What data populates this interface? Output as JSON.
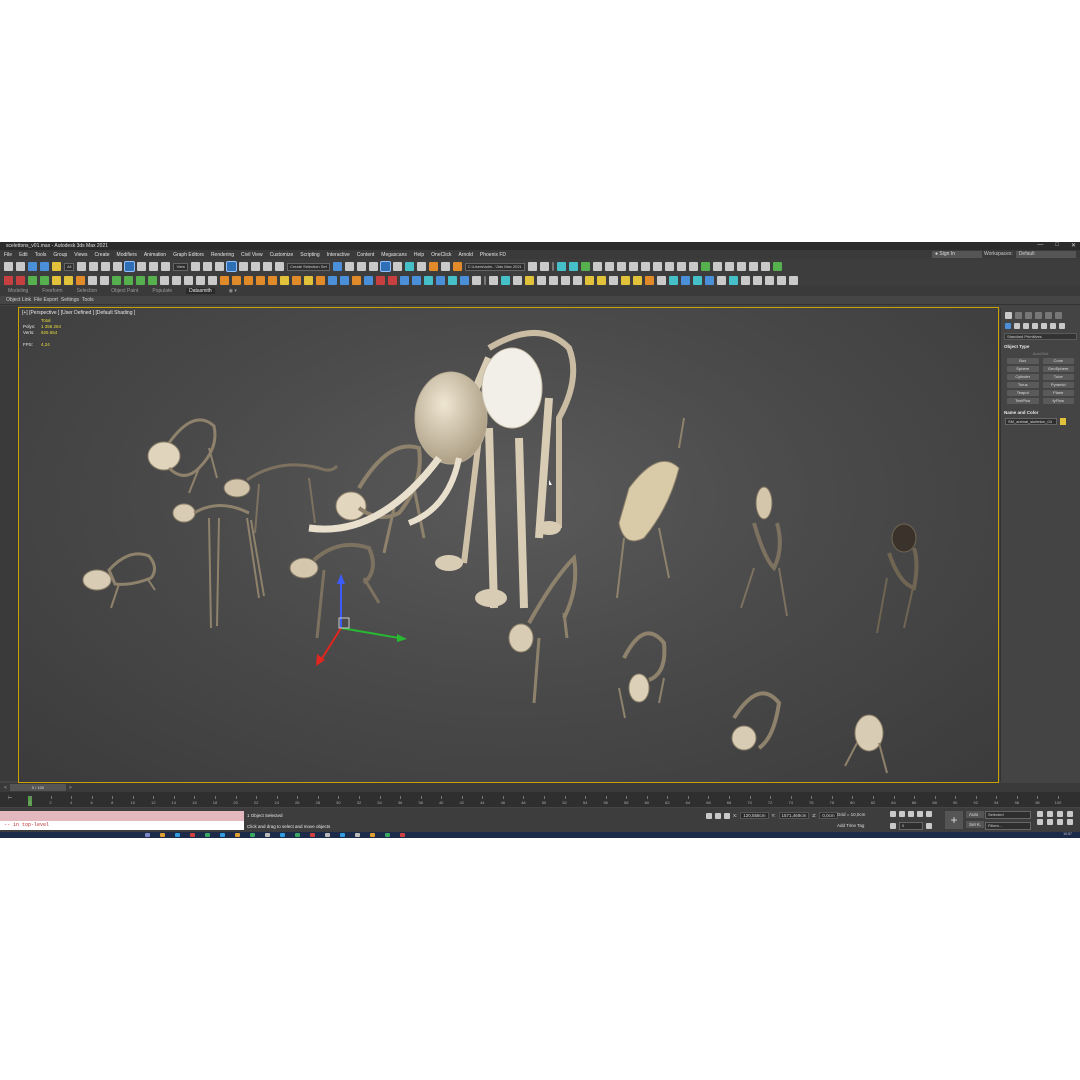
{
  "window": {
    "title": "scelettons_v01.max - Autodesk 3ds Max 2021",
    "controls": [
      "—",
      "□",
      "✕"
    ]
  },
  "menu": [
    "File",
    "Edit",
    "Tools",
    "Group",
    "Views",
    "Create",
    "Modifiers",
    "Animation",
    "Graph Editors",
    "Rendering",
    "Civil View",
    "Customize",
    "Scripting",
    "Interactive",
    "Content",
    "Megascans",
    "Help",
    "OneClick",
    "Arnold",
    "Phoenix FD"
  ],
  "account": {
    "signin": "Sign In",
    "workspaces_label": "Workspaces:",
    "workspace": "Default"
  },
  "toolbar": {
    "filter": "All",
    "refcoord": "View",
    "selection_set": "Create Selection Set",
    "path": "C:\\Users\\adm...\\3ds Max 2021"
  },
  "ribbon": {
    "tabs": [
      "Modeling",
      "Freeform",
      "Selection",
      "Object Paint",
      "Populate",
      "Datasmith"
    ],
    "active": "Datasmith",
    "extra": "◉ ▾"
  },
  "subribbon": [
    "Object Link",
    "File Export",
    "Settings",
    "Tools"
  ],
  "viewport": {
    "label": "[+] [Perspective ] [User Defined ] [Default Shading ]",
    "stats": {
      "header": "Total",
      "polys_label": "Polys:",
      "polys": "1 356 264",
      "verts_label": "Verts:",
      "verts": "925 654",
      "fps_label": "FPS:",
      "fps": "4,24"
    }
  },
  "command_panel": {
    "category": "Standard Primitives",
    "section_object_type": "Object Type",
    "autogrid": "AutoGrid",
    "primitives": [
      "Box",
      "Cone",
      "Sphere",
      "GeoSphere",
      "Cylinder",
      "Tube",
      "Torus",
      "Pyramid",
      "Teapot",
      "Plane",
      "TextPlus",
      "fyFlow"
    ],
    "section_name_color": "Name and Color",
    "object_name": "SM_animal_skeleton_04",
    "object_color": "#e2c23a"
  },
  "timeline": {
    "frame_display": "0 / 100",
    "ticks": [
      "0",
      "2",
      "4",
      "6",
      "8",
      "10",
      "12",
      "14",
      "16",
      "18",
      "20",
      "22",
      "24",
      "26",
      "28",
      "30",
      "32",
      "34",
      "36",
      "38",
      "40",
      "42",
      "44",
      "46",
      "48",
      "50",
      "52",
      "54",
      "56",
      "58",
      "60",
      "62",
      "64",
      "66",
      "68",
      "70",
      "72",
      "74",
      "76",
      "78",
      "80",
      "82",
      "84",
      "86",
      "88",
      "90",
      "92",
      "94",
      "96",
      "98",
      "100"
    ],
    "current_frame": 0
  },
  "status": {
    "maxscript_output": "-- in top-level",
    "selection": "1 Object Selected",
    "prompt": "Click and drag to select and move objects",
    "x_label": "X:",
    "x": "120,558cm",
    "y_label": "Y:",
    "y": "1571,469cm",
    "z_label": "Z:",
    "z": "0,0cm",
    "grid": "Grid = 10,0cm",
    "add_time_tag": "Add Time Tag",
    "auto": "Auto",
    "set_key": "Set K.",
    "selected": "Selected",
    "filters": "Filters...",
    "frame_field": "0"
  },
  "taskbar": {
    "clock": "10:57"
  },
  "colors": {
    "viewport_border": "#c8a200",
    "bone": "#d9ccb4",
    "skull": "#f2efe8",
    "stats": "#e8dc3a"
  }
}
